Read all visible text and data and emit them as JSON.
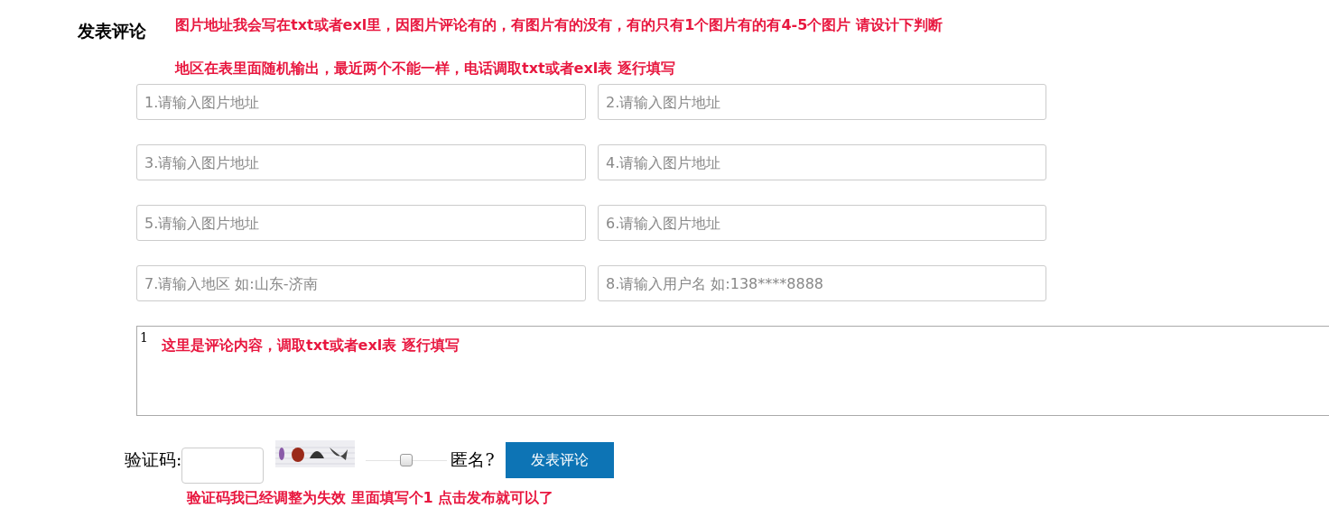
{
  "heading": "发表评论",
  "notes": [
    "图片地址我会写在txt或者exl里，因图片评论有的，有图片有的没有，有的只有1个图片有的有4-5个图片 请设计下判断",
    "地区在表里面随机输出，最近两个不能一样，电话调取txt或者exl表 逐行填写"
  ],
  "fields": [
    {
      "placeholder": "1.请输入图片地址"
    },
    {
      "placeholder": "2.请输入图片地址"
    },
    {
      "placeholder": "3.请输入图片地址"
    },
    {
      "placeholder": "4.请输入图片地址"
    },
    {
      "placeholder": "5.请输入图片地址"
    },
    {
      "placeholder": "6.请输入图片地址"
    },
    {
      "placeholder": "7.请输入地区 如:山东-济南"
    },
    {
      "placeholder": "8.请输入用户名 如:138****8888"
    }
  ],
  "comment": {
    "value": "1",
    "note": "这里是评论内容，调取txt或者exl表 逐行填写"
  },
  "captcha": {
    "label": "验证码:"
  },
  "anonymous": {
    "label": "匿名?",
    "checked": false
  },
  "submit": "发表评论",
  "captcha_note": "验证码我已经调整为失效 里面填写个1 点击发布就可以了"
}
